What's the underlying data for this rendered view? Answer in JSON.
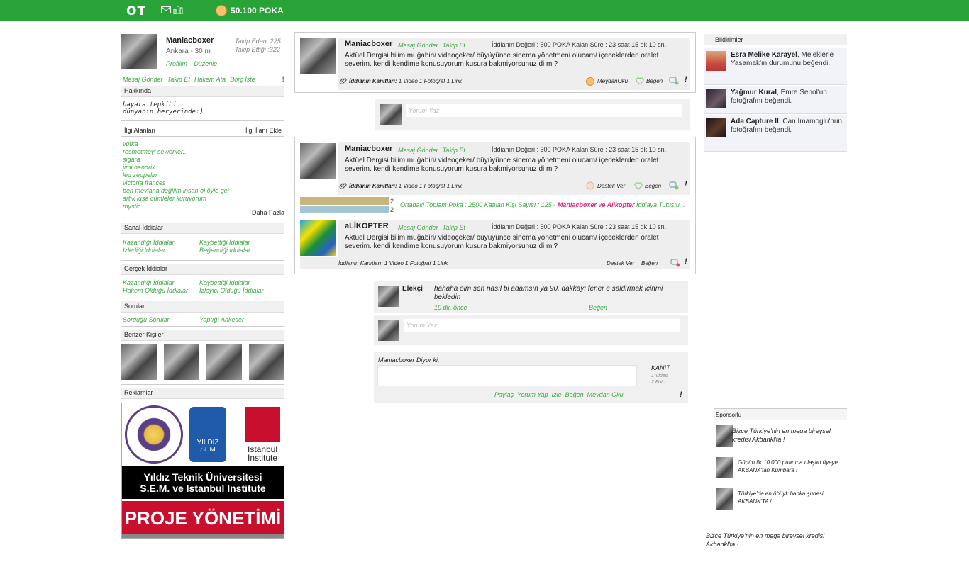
{
  "topbar": {
    "logo": "OT",
    "poka": "50.100 POKA"
  },
  "profile": {
    "name": "Maniacboxer",
    "location": "Ankara - 30 m",
    "followers": "Takip Eden :225",
    "following": "Takip Ettiği :322",
    "links": [
      "Profilim",
      "Düzenle"
    ],
    "actions": [
      "Mesaj Gönder",
      "Takip Et",
      "Hakem Ata",
      "Borç İste"
    ],
    "excl": "!"
  },
  "about": {
    "title": "Hakkında",
    "lines": [
      "hayata tepkiLi",
      "dünyanın heryerinde:)"
    ]
  },
  "interests": {
    "title": "İlgi Alanları",
    "add": "İlgi İlanı Ekle",
    "items": [
      "votka",
      "resmetmeyi sewenler...",
      "sigara",
      "jimi hendrix",
      "led zeppelin",
      "victoria frances",
      "ben mevlana değilim insan ol öyle gel",
      "artık kısa cümleler kuruyorum",
      "mystic"
    ],
    "more": "Daha Fazla"
  },
  "virtual": {
    "title": "Sanal İddialar",
    "links": [
      "Kazandığı İddialar",
      "Kaybettiği İddialar",
      "İzlediği İddialar",
      "Beğendiği İddialar"
    ]
  },
  "real": {
    "title": "Gerçek İddialar",
    "links": [
      "Kazandığı İddialar",
      "Kaybettiği İddialar",
      "Hakem Olduğu İddialar",
      "İzleyici Olduğu İddialar"
    ]
  },
  "questions": {
    "title": "Sorular",
    "links": [
      "Sorduğu Sorular",
      "Yaptığı Anketler"
    ]
  },
  "similar": {
    "title": "Benzer Kişiler"
  },
  "ads": {
    "title": "Reklamlar",
    "line1": "Yıldız Teknik Üniversitesi",
    "line2": "S.E.M. ve Istanbul Institute",
    "banner": "PROJE YÖNETİMİ",
    "logo_mid": "YILDIZ SEM",
    "logo_right_1": "Istanbul",
    "logo_right_2": "Institute"
  },
  "post1": {
    "name": "Maniacboxer",
    "links": [
      "Mesaj Gönder",
      "Takip Et"
    ],
    "meta": "İddianın Değeri : 500 POKA Kalan Süre : 23 saat 15 dk 10 sn.",
    "text": "Aktüel Dergisi bilim muğabiri/ videoçeker/ büyüyünce sinema yönetmeni olucam/ içeceklerden oralet severim. kendi kendime konusuyorum kusura bakmiyorsunuz di mi?",
    "evidence_label": "İddianın Kanıtları:",
    "evidence": "1 Video 1 Fotoğraf 1 Link",
    "actions": [
      "MeydanOku",
      "Beğen"
    ],
    "excl": "!"
  },
  "comment1": {
    "placeholder": "Yorum Yaz"
  },
  "post2": {
    "name": "Maniacboxer",
    "links": [
      "Mesaj Gönder",
      "Takip Et"
    ],
    "meta": "İddianın Değeri : 500 POKA Kalan Süre : 23 saat 15 dk 10 sn.",
    "text": "Aktüel Dergisi bilim muğabiri/ videoçeker/ büyüyünce sinema yönetmeni olucam/ içeceklerden oralet severim. kendi kendime konusuyorum kusura bakmiyorsunuz di mi?",
    "evidence_label": "İddianın Kanıtları:",
    "evidence": "1 Video 1 Fotoğraf 1 Link",
    "actions": [
      "Destek Ver",
      "Beğen"
    ],
    "excl": "!",
    "bar_counts": [
      "2",
      "2"
    ],
    "stats": "Ortadaki Toplam Poka : 2500   Katılan Kişi Sayısı : 125 -",
    "stats_names": "Maniacboxer ve Alikopter",
    "stats_tail": "İddiaya Tutuştu..."
  },
  "post3": {
    "name": "aLİKOPTER",
    "links": [
      "Mesaj Gönder",
      "Takip Et"
    ],
    "meta": "İddianın Değeri : 500 POKA Kalan Süre : 23 saat 15 dk 10 sn.",
    "text": "Aktüel Dergisi bilim muğabiri/ videoçeker/ büyüyünce sinema yönetmeni olucam/ içeceklerden oralet severim. kendi kendime konusuyorum kusura bakmiyorsunuz di mi?",
    "evidence": "İddianın Kanıtları: 1 Video 1 Fotoğraf 1 Link",
    "actions": [
      "Destek Ver",
      "Beğen"
    ],
    "excl": "!"
  },
  "reply": {
    "name": "Elekçi",
    "text": "hahaha olm sen nasıl bi adamsın ya 90. dakkayı fener e saldırmak icinmi bekledin",
    "time": "10 dk. önce",
    "like": "Beğen"
  },
  "comment2": {
    "placeholder": "Yorum Yaz"
  },
  "composer": {
    "title": "Maniacboxer Diyor ki;",
    "kanit": "KANIT",
    "kanit_video": "1 Video",
    "kanit_foto": "2 Foto",
    "actions": [
      "Paylaş",
      "Yorum Yap",
      "İzle",
      "Beğen",
      "Meydan Oku"
    ],
    "excl": "!"
  },
  "notifications": {
    "title": "Bildirimler",
    "items": [
      {
        "name": "Esra Melike Karayel",
        "text": ", Meleklerle Yasamak'ın durumunu beğendi."
      },
      {
        "name": "Yağmur Kural",
        "text": ", Emre Senol'un fotoğrafını beğendi."
      },
      {
        "name": "Ada Capture II",
        "text": ", Can Imamoglu'nun fotoğrafını beğendi."
      }
    ]
  },
  "sponsor": {
    "title": "Sponsorlu",
    "items": [
      "Bizce Türkiye'nin en mega bireysel kredisi Akbankl'ta !",
      "Günün ilk 10 000 puanına ulaşan üyeye AKBANK'tan Kumbara !",
      "Türkiye'de en übüyk banka şubesi AKBANK'TA !"
    ],
    "footer": "Bizce Türkiye'nin en mega bireysel kredisi Akbankl'ta !"
  },
  "colors": {
    "brand": "#27a338",
    "link": "#3aa83f",
    "highlight": "#e0267a"
  }
}
